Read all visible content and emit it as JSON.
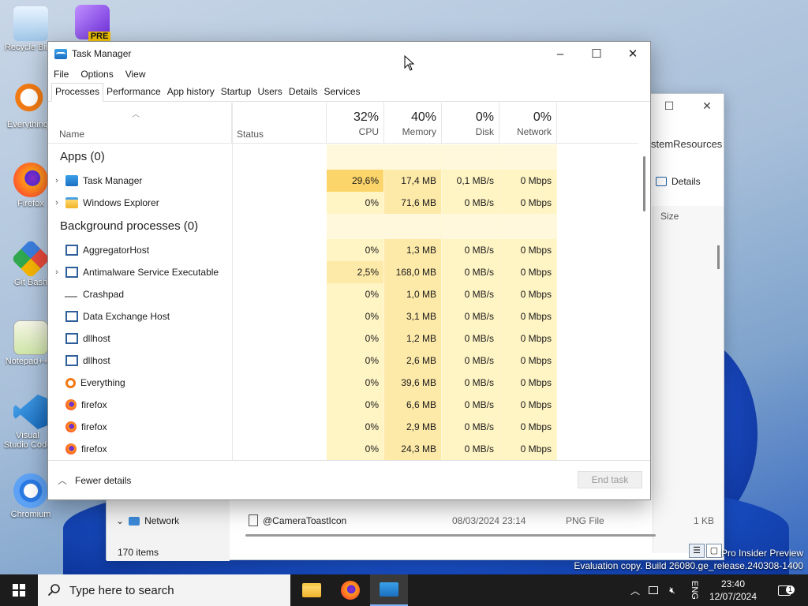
{
  "desktop": {
    "icons": [
      {
        "label": "Recycle Bin"
      },
      {
        "label": "PRE"
      },
      {
        "label": "Everything"
      },
      {
        "label": "Firefox"
      },
      {
        "label": "Git Bash"
      },
      {
        "label": "Notepad++"
      },
      {
        "label": "Visual Studio Code"
      },
      {
        "label": "Chromium"
      }
    ],
    "watermark_line1": "Pro Insider Preview",
    "watermark_line2": "Evaluation copy. Build 26080.ge_release.240308-1400"
  },
  "explorer": {
    "crumb": "stemResources",
    "details_label": "Details",
    "size_header": "Size",
    "nav_item": "Network",
    "file_row": {
      "name": "@CameraToastIcon",
      "date": "08/03/2024 23:14",
      "type": "PNG File",
      "size": "1 KB"
    },
    "item_count": "170 items"
  },
  "task_manager": {
    "title": "Task Manager",
    "menu": [
      "File",
      "Options",
      "View"
    ],
    "tabs": [
      "Processes",
      "Performance",
      "App history",
      "Startup",
      "Users",
      "Details",
      "Services"
    ],
    "active_tab": "Processes",
    "columns": {
      "name": "Name",
      "status": "Status",
      "cpu": {
        "pct": "32%",
        "label": "CPU"
      },
      "memory": {
        "pct": "40%",
        "label": "Memory"
      },
      "disk": {
        "pct": "0%",
        "label": "Disk"
      },
      "network": {
        "pct": "0%",
        "label": "Network"
      }
    },
    "groups": {
      "apps": "Apps (0)",
      "background": "Background processes (0)"
    },
    "apps": [
      {
        "name": "Task Manager",
        "cpu": "29,6%",
        "memory": "17,4 MB",
        "disk": "0,1 MB/s",
        "network": "0 Mbps",
        "icon": "task-manager-icon"
      },
      {
        "name": "Windows Explorer",
        "cpu": "0%",
        "memory": "71,6 MB",
        "disk": "0 MB/s",
        "network": "0 Mbps",
        "icon": "folder-icon"
      }
    ],
    "background": [
      {
        "name": "AggregatorHost",
        "cpu": "0%",
        "memory": "1,3 MB",
        "disk": "0 MB/s",
        "network": "0 Mbps",
        "icon": "service-icon"
      },
      {
        "name": "Antimalware Service Executable",
        "cpu": "2,5%",
        "memory": "168,0 MB",
        "disk": "0 MB/s",
        "network": "0 Mbps",
        "icon": "service-icon"
      },
      {
        "name": "Crashpad",
        "cpu": "0%",
        "memory": "1,0 MB",
        "disk": "0 MB/s",
        "network": "0 Mbps",
        "icon": "pulse-icon"
      },
      {
        "name": "Data Exchange Host",
        "cpu": "0%",
        "memory": "3,1 MB",
        "disk": "0 MB/s",
        "network": "0 Mbps",
        "icon": "service-icon"
      },
      {
        "name": "dllhost",
        "cpu": "0%",
        "memory": "1,2 MB",
        "disk": "0 MB/s",
        "network": "0 Mbps",
        "icon": "service-icon"
      },
      {
        "name": "dllhost",
        "cpu": "0%",
        "memory": "2,6 MB",
        "disk": "0 MB/s",
        "network": "0 Mbps",
        "icon": "service-icon"
      },
      {
        "name": "Everything",
        "cpu": "0%",
        "memory": "39,6 MB",
        "disk": "0 MB/s",
        "network": "0 Mbps",
        "icon": "magnifier-icon"
      },
      {
        "name": "firefox",
        "cpu": "0%",
        "memory": "6,6 MB",
        "disk": "0 MB/s",
        "network": "0 Mbps",
        "icon": "firefox-icon"
      },
      {
        "name": "firefox",
        "cpu": "0%",
        "memory": "2,9 MB",
        "disk": "0 MB/s",
        "network": "0 Mbps",
        "icon": "firefox-icon"
      },
      {
        "name": "firefox",
        "cpu": "0%",
        "memory": "24,3 MB",
        "disk": "0 MB/s",
        "network": "0 Mbps",
        "icon": "firefox-icon"
      }
    ],
    "fewer_details": "Fewer details",
    "end_task": "End task"
  },
  "taskbar": {
    "search_placeholder": "Type here to search",
    "lang": "ENG",
    "time": "23:40",
    "date": "12/07/2024",
    "notifications": "1"
  },
  "colors": {
    "heat_high": "#fbd56a",
    "heat_med": "#fde9a8",
    "heat_low": "#fff4c4",
    "heat_group": "#fff8dc",
    "taskbar": "#1c1c1c"
  }
}
